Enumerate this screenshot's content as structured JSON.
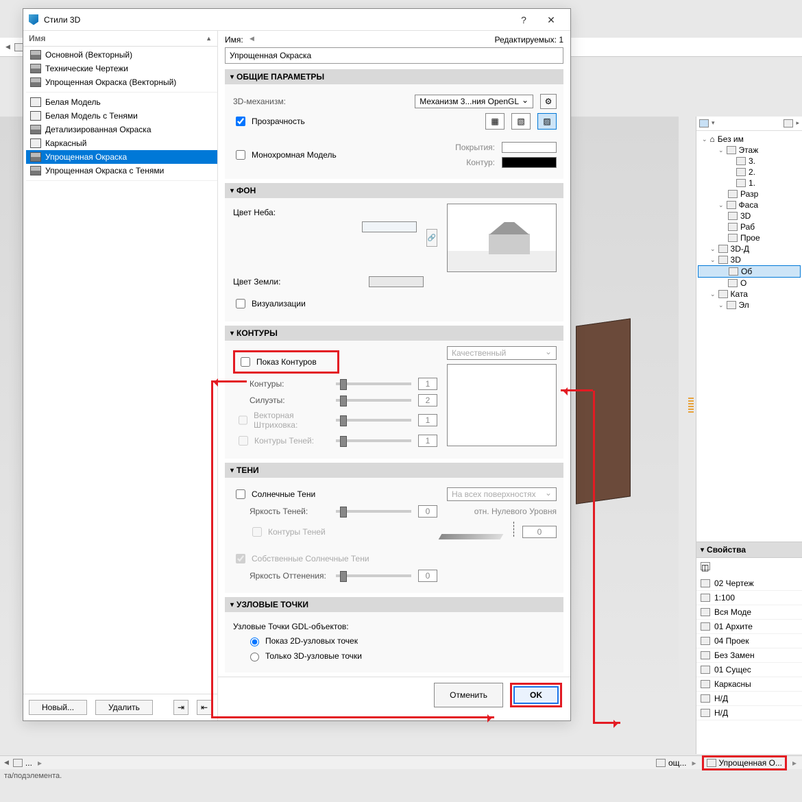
{
  "window": {
    "title": "Стили 3D",
    "help": "?",
    "close": "✕"
  },
  "left": {
    "header": "Имя",
    "groups": [
      {
        "items": [
          {
            "label": "Основной (Векторный)",
            "icon": "vec"
          },
          {
            "label": "Технические Чертежи",
            "icon": "vec"
          },
          {
            "label": "Упрощенная Окраска (Векторный)",
            "icon": "vec"
          }
        ]
      },
      {
        "items": [
          {
            "label": "Белая Модель",
            "icon": "light"
          },
          {
            "label": "Белая Модель с Тенями",
            "icon": "light"
          },
          {
            "label": "Детализированная Окраска",
            "icon": "vec"
          },
          {
            "label": "Каркасный",
            "icon": "light"
          },
          {
            "label": "Упрощенная Окраска",
            "icon": "vec",
            "selected": true
          },
          {
            "label": "Упрощенная Окраска с Тенями",
            "icon": "vec"
          }
        ]
      }
    ],
    "new": "Новый...",
    "delete": "Удалить"
  },
  "right": {
    "name_label": "Имя:",
    "editable": "Редактируемых: 1",
    "name_value": "Упрощенная Окраска",
    "sections": {
      "general": {
        "title": "ОБЩИЕ ПАРАМЕТРЫ",
        "engine_label": "3D-механизм:",
        "engine_value": "Механизм 3...ния OpenGL",
        "transparency": "Прозрачность",
        "mono": "Монохромная Модель",
        "surfaces": "Покрытия:",
        "contour": "Контур:"
      },
      "background": {
        "title": "ФОН",
        "sky": "Цвет Неба:",
        "ground": "Цвет Земли:",
        "visual": "Визуализации"
      },
      "contours": {
        "title": "КОНТУРЫ",
        "show": "Показ Контуров",
        "quality": "Качественный",
        "r1": "Контуры:",
        "v1": "1",
        "r2": "Силуэты:",
        "v2": "2",
        "r3": "Векторная Штриховка:",
        "v3": "1",
        "r4": "Контуры Теней:",
        "v4": "1"
      },
      "shadows": {
        "title": "ТЕНИ",
        "sun": "Солнечные Тени",
        "surfaces": "На всех поверхностях",
        "brightness": "Яркость Теней:",
        "bv": "0",
        "shadow_contours": "Контуры Теней",
        "rel": "отн. Нулевого Уровня",
        "rv": "0",
        "own": "Собственные Солнечные Тени",
        "tint": "Яркость Оттенения:",
        "tv": "0"
      },
      "nodes": {
        "title": "УЗЛОВЫЕ ТОЧКИ",
        "label": "Узловые Точки GDL-объектов:",
        "opt1": "Показ 2D-узловых точек",
        "opt2": "Только 3D-узловые точки"
      }
    },
    "cancel": "Отменить",
    "ok": "OK"
  },
  "navigator": {
    "root": "Без им",
    "items": [
      {
        "lvl": 2,
        "label": "Этаж",
        "exp": true
      },
      {
        "lvl": 3,
        "label": "3."
      },
      {
        "lvl": 3,
        "label": "2."
      },
      {
        "lvl": 3,
        "label": "1."
      },
      {
        "lvl": 2,
        "label": "Разр"
      },
      {
        "lvl": 2,
        "label": "Фаса",
        "exp": true
      },
      {
        "lvl": 2,
        "label": "3D"
      },
      {
        "lvl": 2,
        "label": "Раб"
      },
      {
        "lvl": 2,
        "label": "Прое"
      },
      {
        "lvl": 1,
        "label": "3D-Д",
        "exp": true
      },
      {
        "lvl": 1,
        "label": "3D",
        "exp": true
      },
      {
        "lvl": 2,
        "label": "Об",
        "sel": true
      },
      {
        "lvl": 2,
        "label": "О"
      },
      {
        "lvl": 1,
        "label": "Ката",
        "exp": true
      },
      {
        "lvl": 2,
        "label": "Эл",
        "exp": true
      }
    ]
  },
  "props": {
    "title": "Свойства",
    "rows": [
      "02 Чертеж",
      "1:100",
      "Вся Моде",
      "01 Архите",
      "04 Проек",
      "Без Замен",
      "01 Сущес",
      "Каркасны",
      "Н/Д",
      "Н/Д"
    ]
  },
  "status": {
    "crumb2": "ощ...",
    "crumb3": "Упрощенная О...",
    "sub": "та/подэлемента."
  }
}
